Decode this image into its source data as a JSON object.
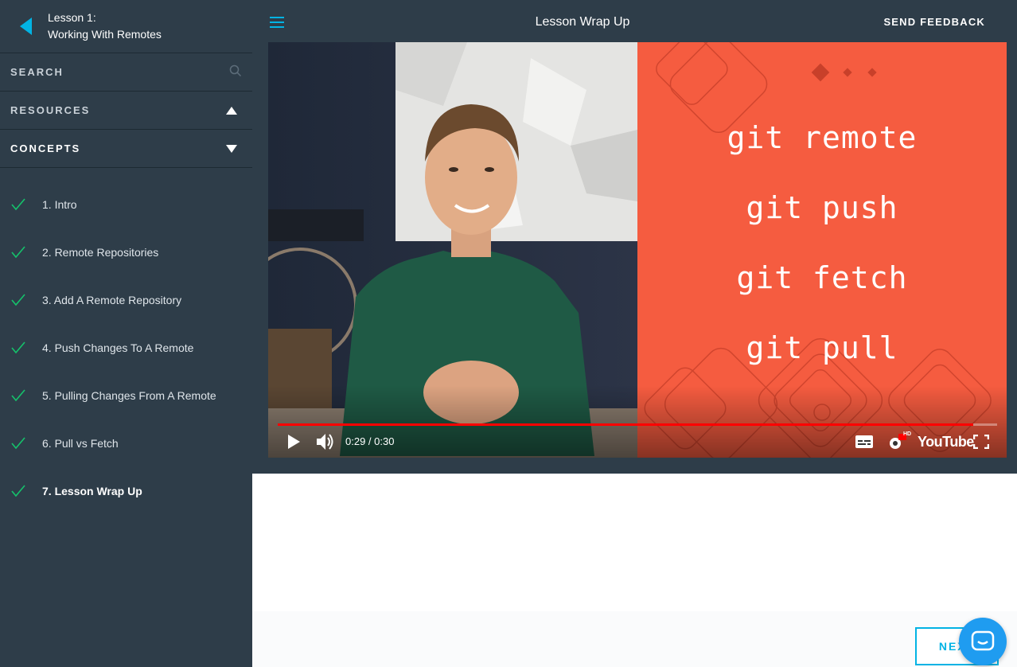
{
  "lesson": {
    "number_label": "Lesson 1:",
    "title": "Working With Remotes"
  },
  "sidebar": {
    "search_placeholder": "SEARCH",
    "resources_label": "RESOURCES",
    "concepts_label": "CONCEPTS",
    "concepts": [
      {
        "label": "1. Intro",
        "completed": true,
        "active": false
      },
      {
        "label": "2. Remote Repositories",
        "completed": true,
        "active": false
      },
      {
        "label": "3. Add A Remote Repository",
        "completed": true,
        "active": false
      },
      {
        "label": "4. Push Changes To A Remote",
        "completed": true,
        "active": false
      },
      {
        "label": "5. Pulling Changes From A Remote",
        "completed": true,
        "active": false
      },
      {
        "label": "6. Pull vs Fetch",
        "completed": true,
        "active": false
      },
      {
        "label": "7. Lesson Wrap Up",
        "completed": true,
        "active": true
      }
    ]
  },
  "header": {
    "title": "Lesson Wrap Up",
    "feedback_label": "SEND FEEDBACK"
  },
  "video": {
    "slide_lines": [
      "git remote",
      "git push",
      "git fetch",
      "git pull"
    ],
    "time_display": "0:29 / 0:30",
    "progress_fraction": 0.967,
    "brand_label": "YouTube",
    "hd_badge": "HD"
  },
  "footer": {
    "next_label": "NEXT"
  },
  "colors": {
    "sidebar_bg": "#2e3d49",
    "accent": "#02b3e4",
    "check": "#15c26b",
    "slide_bg": "#f55c40",
    "progress": "#ff0000",
    "chat_button": "#1f9cf0"
  },
  "icons": {
    "back": "back-arrow-icon",
    "search": "search-icon",
    "menu": "hamburger-menu-icon",
    "check": "checkmark-icon",
    "play": "play-icon",
    "volume": "volume-icon",
    "captions": "captions-icon",
    "settings": "settings-gear-icon",
    "fullscreen": "fullscreen-icon",
    "chat": "chat-bubble-icon"
  }
}
